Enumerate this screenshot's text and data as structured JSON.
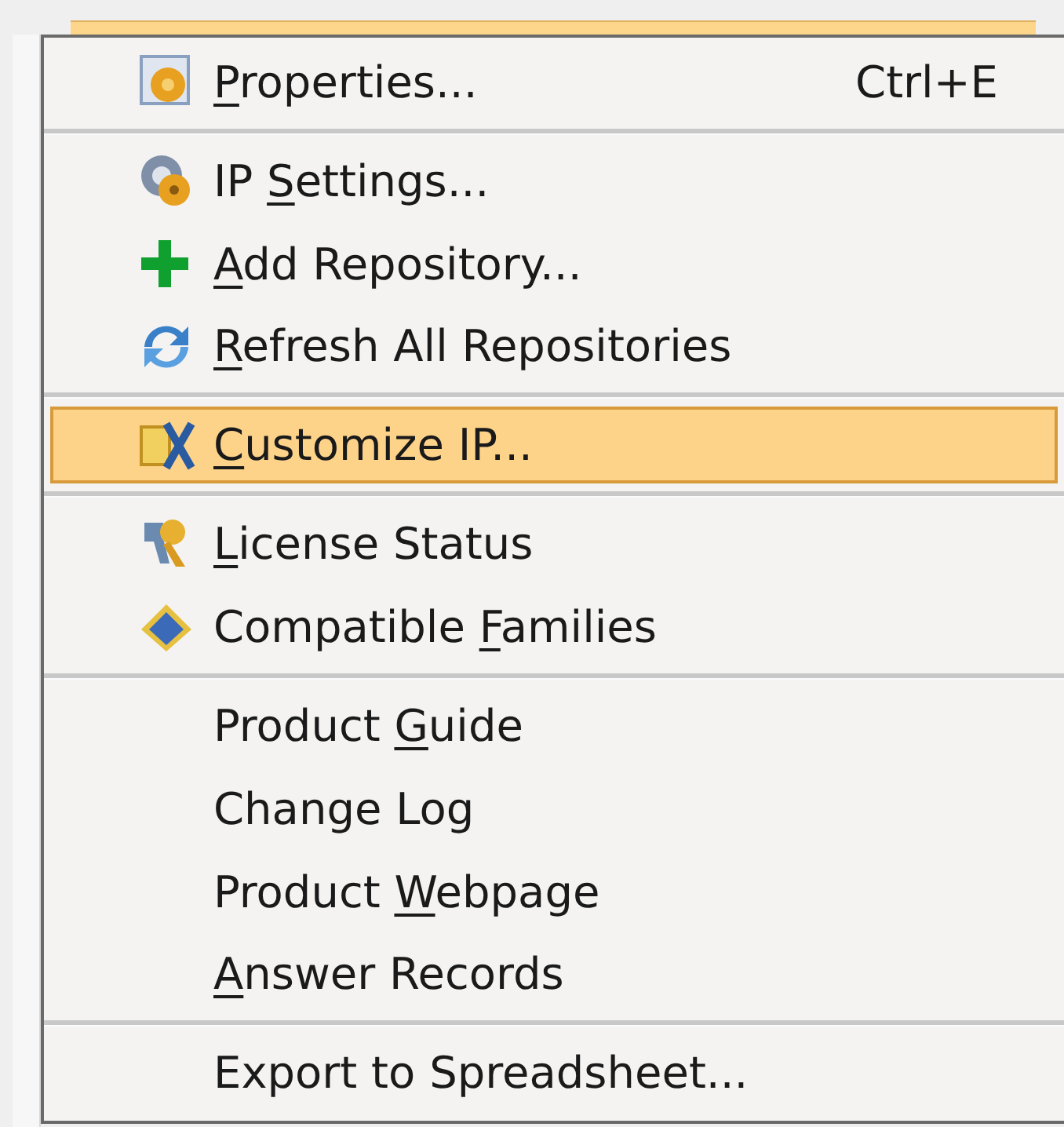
{
  "context_menu": {
    "entries": [
      {
        "kind": "item",
        "label": {
          "key": "P",
          "post": "roperties..."
        },
        "shortcut": "Ctrl+E",
        "selected": false
      },
      {
        "kind": "separator"
      },
      {
        "kind": "item",
        "label": {
          "pre": "IP ",
          "key": "S",
          "post": "ettings..."
        },
        "selected": false
      },
      {
        "kind": "item",
        "label": {
          "key": "A",
          "post": "dd Repository..."
        },
        "selected": false
      },
      {
        "kind": "item",
        "label": {
          "key": "R",
          "post": "efresh All Repositories"
        },
        "selected": false
      },
      {
        "kind": "separator"
      },
      {
        "kind": "item",
        "label": {
          "key": "C",
          "post": "ustomize IP..."
        },
        "selected": true
      },
      {
        "kind": "separator"
      },
      {
        "kind": "item",
        "label": {
          "key": "L",
          "post": "icense Status"
        },
        "selected": false
      },
      {
        "kind": "item",
        "label": {
          "pre": "Compatible ",
          "key": "F",
          "post": "amilies"
        },
        "selected": false
      },
      {
        "kind": "separator"
      },
      {
        "kind": "item",
        "label": {
          "pre": "Product ",
          "key": "G",
          "post": "uide"
        },
        "selected": false
      },
      {
        "kind": "item",
        "label": {
          "pre": "Change Log"
        },
        "selected": false
      },
      {
        "kind": "item",
        "label": {
          "pre": "Product ",
          "key": "W",
          "post": "ebpage"
        },
        "selected": false
      },
      {
        "kind": "item",
        "label": {
          "key": "A",
          "post": "nswer Records"
        },
        "selected": false
      },
      {
        "kind": "separator"
      },
      {
        "kind": "item",
        "label": {
          "pre": "Export to Spreadsheet..."
        },
        "selected": false
      }
    ]
  }
}
